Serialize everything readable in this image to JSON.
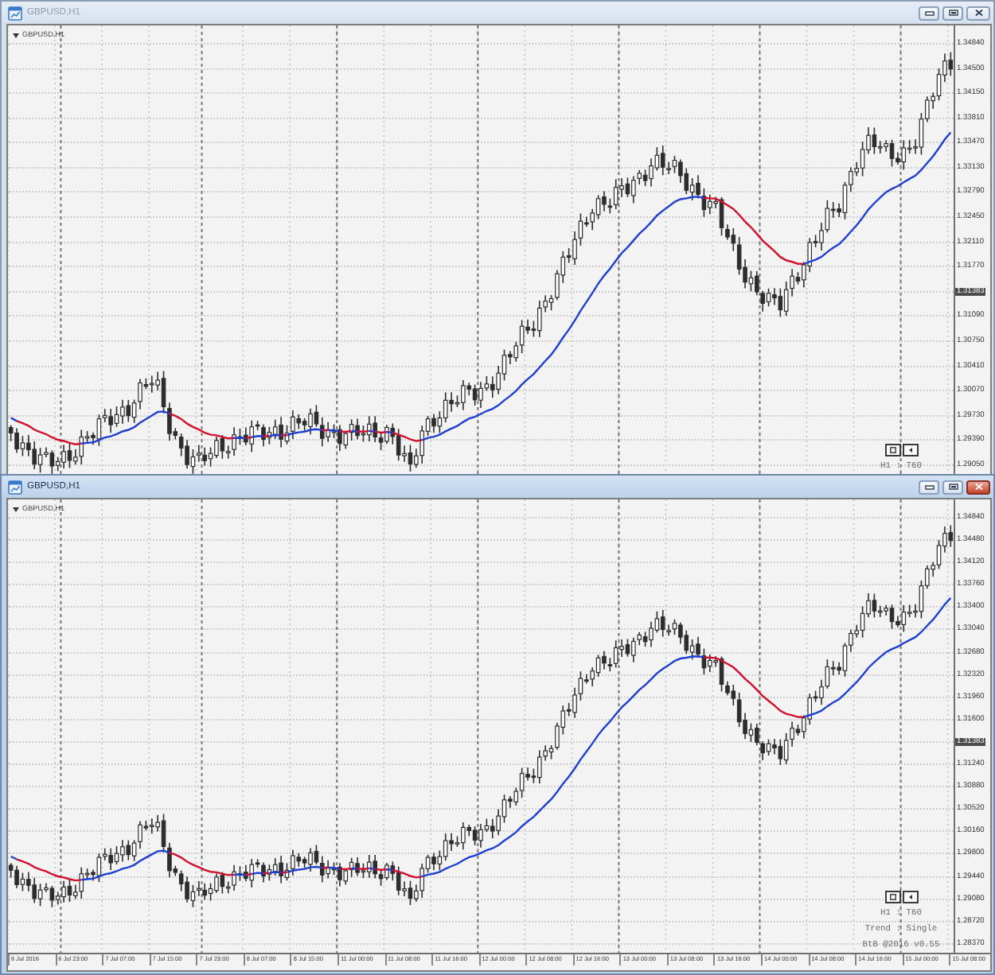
{
  "windows": [
    {
      "title": "GBPUSD,H1",
      "active": false,
      "chart": {
        "symbol_label": "GBPUSD,H1",
        "price_axis": [
          {
            "text": "1.34840",
            "kind": "tick"
          },
          {
            "text": "1.34500",
            "kind": "tick"
          },
          {
            "text": "1.34150",
            "kind": "tick"
          },
          {
            "text": "1.33810",
            "kind": "tick"
          },
          {
            "text": "1.33470",
            "kind": "tick"
          },
          {
            "text": "1.33130",
            "kind": "tick"
          },
          {
            "text": "1.32790",
            "kind": "tick"
          },
          {
            "text": "1.32450",
            "kind": "tick"
          },
          {
            "text": "1.32110",
            "kind": "tick"
          },
          {
            "text": "1.31770",
            "kind": "tick"
          },
          {
            "text": "1.31383",
            "kind": "current"
          },
          {
            "text": "1.31090",
            "kind": "tick"
          },
          {
            "text": "1.30750",
            "kind": "tick"
          },
          {
            "text": "1.30410",
            "kind": "tick"
          },
          {
            "text": "1.30070",
            "kind": "tick"
          },
          {
            "text": "1.29730",
            "kind": "tick"
          },
          {
            "text": "1.29390",
            "kind": "tick"
          },
          {
            "text": "1.29050",
            "kind": "tick"
          }
        ],
        "info_lines": [
          "H1 : T60"
        ]
      }
    },
    {
      "title": "GBPUSD,H1",
      "active": true,
      "chart": {
        "symbol_label": "GBPUSD,H1",
        "price_axis": [
          {
            "text": "1.34840",
            "kind": "tick"
          },
          {
            "text": "1.34480",
            "kind": "tick"
          },
          {
            "text": "1.34120",
            "kind": "tick"
          },
          {
            "text": "1.33760",
            "kind": "tick"
          },
          {
            "text": "1.33400",
            "kind": "tick"
          },
          {
            "text": "1.33040",
            "kind": "tick"
          },
          {
            "text": "1.32680",
            "kind": "tick"
          },
          {
            "text": "1.32320",
            "kind": "tick"
          },
          {
            "text": "1.31960",
            "kind": "tick"
          },
          {
            "text": "1.31600",
            "kind": "tick"
          },
          {
            "text": "1.31383",
            "kind": "current"
          },
          {
            "text": "1.31240",
            "kind": "tick"
          },
          {
            "text": "1.30880",
            "kind": "tick"
          },
          {
            "text": "1.30520",
            "kind": "tick"
          },
          {
            "text": "1.30160",
            "kind": "tick"
          },
          {
            "text": "1.29800",
            "kind": "tick"
          },
          {
            "text": "1.29440",
            "kind": "tick"
          },
          {
            "text": "1.29080",
            "kind": "tick"
          },
          {
            "text": "1.28720",
            "kind": "tick"
          },
          {
            "text": "1.28370",
            "kind": "tick"
          }
        ],
        "info_lines": [
          "H1 : T60",
          "Trend : Single",
          "BtB @2016 v0.55"
        ],
        "time_axis": [
          "6 Jul 2016",
          "6 Jul 23:00",
          "7 Jul 07:00",
          "7 Jul 15:00",
          "7 Jul 23:00",
          "8 Jul 07:00",
          "8 Jul 15:00",
          "11 Jul 00:00",
          "11 Jul 08:00",
          "11 Jul 16:00",
          "12 Jul 00:00",
          "12 Jul 08:00",
          "12 Jul 16:00",
          "13 Jul 00:00",
          "13 Jul 08:00",
          "13 Jul 16:00",
          "14 Jul 00:00",
          "14 Jul 08:00",
          "14 Jul 16:00",
          "15 Jul 00:00",
          "15 Jul 08:00"
        ]
      }
    }
  ]
}
